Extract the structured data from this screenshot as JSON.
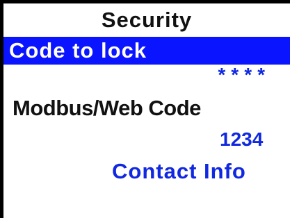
{
  "header": {
    "title": "Security"
  },
  "menu": {
    "items": [
      {
        "label": "Code to lock",
        "value": "****",
        "selected": true
      },
      {
        "label": "Modbus/Web Code",
        "value": "1234",
        "selected": false
      },
      {
        "label": "Contact Info",
        "selected": false
      }
    ]
  },
  "colors": {
    "selection_background": "#0a14ff",
    "selection_text": "#ffffff",
    "value_text": "#1028e0",
    "label_text": "#111111",
    "border": "#000000",
    "background": "#ffffff"
  }
}
